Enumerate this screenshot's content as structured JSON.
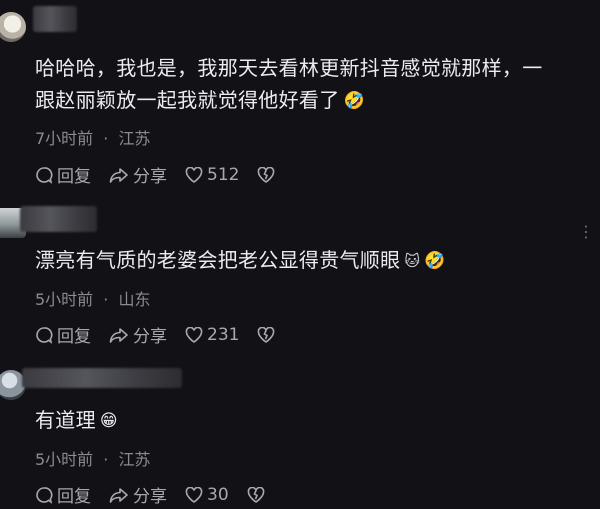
{
  "comments": [
    {
      "text_line1": "哈哈哈，我也是，我那天去看林更新抖音感觉就那样，一",
      "text_line2": "跟赵丽颖放一起我就觉得他好看了",
      "emoji": "🤣",
      "time": "7小时前",
      "location": "江苏",
      "reply_label": "回复",
      "share_label": "分享",
      "likes": "512"
    },
    {
      "text_line1": "漂亮有气质的老婆会把老公显得贵气顺眼",
      "emoji_cat": "🐱",
      "emoji": "🤣",
      "time": "5小时前",
      "location": "山东",
      "reply_label": "回复",
      "share_label": "分享",
      "likes": "231"
    },
    {
      "text_line1": "有道理",
      "emoji": "😁",
      "time": "5小时前",
      "location": "江苏",
      "reply_label": "回复",
      "share_label": "分享",
      "likes": "30"
    }
  ],
  "separator": "·",
  "colors": {
    "background": "#121216",
    "text": "#ececf0",
    "meta": "#8a8a92",
    "actions": "#a8a8b0"
  }
}
